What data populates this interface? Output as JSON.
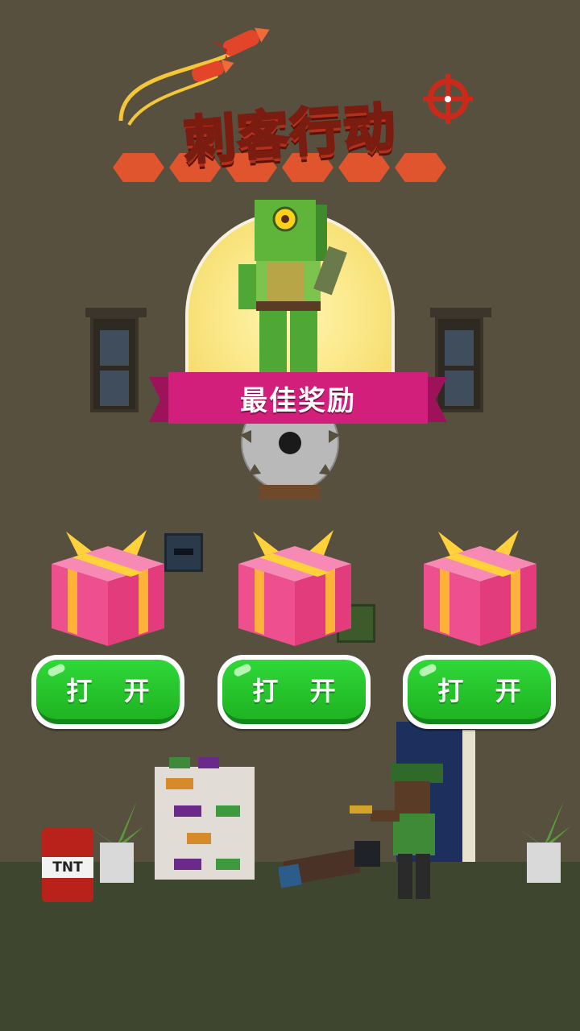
{
  "game": {
    "title": "刺客行动",
    "reward_banner": "最佳奖励",
    "scene_sign": "TNT",
    "gifts": [
      {
        "open_label": "打 开"
      },
      {
        "open_label": "打 开"
      },
      {
        "open_label": "打 开"
      }
    ]
  },
  "colors": {
    "background": "#57503f",
    "title_yellow": "#ffd22e",
    "banner_magenta": "#d21f7c",
    "button_green": "#22c12a",
    "gift_pink": "#ee4f8f",
    "ribbon_yellow": "#ffd23b"
  },
  "icons": [
    "rocket-icon",
    "crosshair-icon",
    "gift-box-icon",
    "saw-blade-icon",
    "tnt-icon"
  ]
}
